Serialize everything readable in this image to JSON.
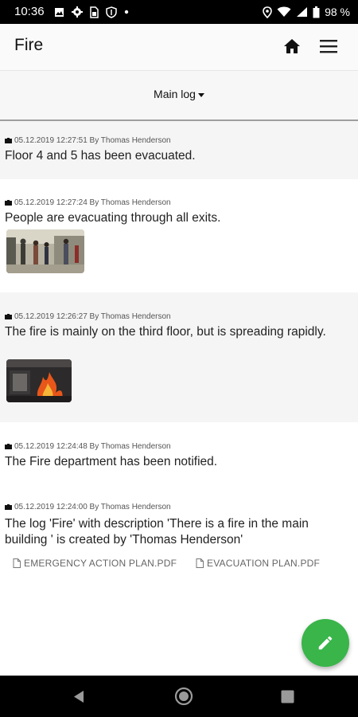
{
  "status_bar": {
    "time": "10:36",
    "battery": "98 %",
    "left_icons": [
      "image-icon",
      "settings-icon",
      "sim-icon",
      "shield-icon",
      "dot-icon"
    ],
    "right_icons": [
      "location-icon",
      "wifi-icon",
      "signal-icon",
      "battery-icon"
    ]
  },
  "app_bar": {
    "title": "Fire",
    "icons": [
      "home-icon",
      "menu-icon"
    ]
  },
  "log_selector": {
    "label": "Main log"
  },
  "entries": [
    {
      "meta": "05.12.2019 12:27:51 By Thomas Henderson",
      "text": "Floor 4 and 5 has been evacuated."
    },
    {
      "meta": "05.12.2019 12:27:24 By Thomas Henderson",
      "text": "People are evacuating through all exits.",
      "image": "evacuation-photo"
    },
    {
      "meta": "05.12.2019 12:26:27 By Thomas Henderson",
      "text": "The fire is mainly on the third floor, but is spreading rapidly.",
      "image": "fire-photo"
    },
    {
      "meta": "05.12.2019 12:24:48 By Thomas Henderson",
      "text": "The Fire department has been notified."
    },
    {
      "meta": "05.12.2019 12:24:00 By Thomas Henderson",
      "text": "The log 'Fire' with description 'There is a fire in the main building  ' is created by 'Thomas Henderson'",
      "attachments": [
        "EMERGENCY ACTION PLAN.PDF",
        "EVACUATION PLAN.PDF"
      ]
    }
  ],
  "fab": {
    "icon": "pencil-icon",
    "color": "#39b54a"
  },
  "nav_bar": {
    "icons": [
      "back-icon",
      "home-button-icon",
      "recents-icon"
    ]
  }
}
